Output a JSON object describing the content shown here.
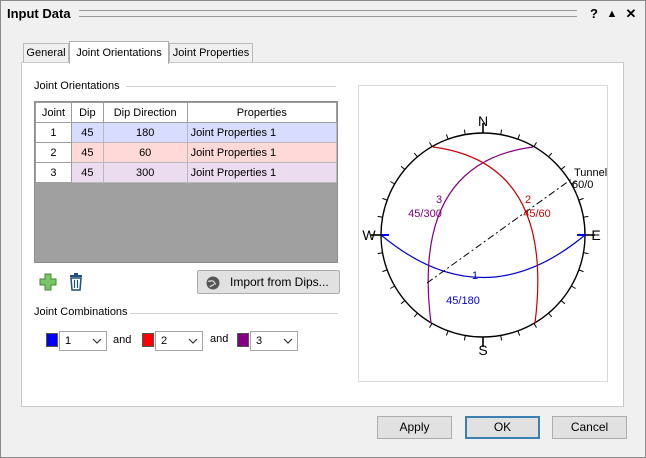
{
  "window": {
    "title": "Input Data"
  },
  "titlebar_buttons": {
    "help": "?",
    "up": "▲",
    "close": "✕"
  },
  "tabs": [
    {
      "label": "General"
    },
    {
      "label": "Joint Orientations"
    },
    {
      "label": "Joint Properties"
    }
  ],
  "joint_orientations": {
    "section_title": "Joint Orientations",
    "columns": [
      "Joint",
      "Dip",
      "Dip Direction",
      "Properties"
    ],
    "rows": [
      {
        "joint": "1",
        "dip": "45",
        "dip_direction": "180",
        "properties": "Joint Properties 1",
        "color": "#d8dcff"
      },
      {
        "joint": "2",
        "dip": "45",
        "dip_direction": "60",
        "properties": "Joint Properties 1",
        "color": "#ffd8d8"
      },
      {
        "joint": "3",
        "dip": "45",
        "dip_direction": "300",
        "properties": "Joint Properties 1",
        "color": "#ecdcf0"
      }
    ],
    "add_icon": "plus-icon",
    "delete_icon": "trash-icon",
    "import_button": "Import from Dips..."
  },
  "joint_combinations": {
    "section_title": "Joint Combinations",
    "and_label": "and",
    "combos": [
      {
        "value": "1",
        "color": "#0000ff"
      },
      {
        "value": "2",
        "color": "#ff0000"
      },
      {
        "value": "3",
        "color": "#800080"
      }
    ]
  },
  "stereonet": {
    "north": "N",
    "south": "S",
    "east": "E",
    "west": "W",
    "tunnel_label": "Tunnel",
    "tunnel_value": "60/0",
    "joint_labels": [
      {
        "id": "1",
        "orientation": "45/180",
        "color": "#0000cc"
      },
      {
        "id": "2",
        "orientation": "45/60",
        "color": "#cc0000"
      },
      {
        "id": "3",
        "orientation": "45/300",
        "color": "#800080"
      }
    ]
  },
  "buttons": {
    "apply": "Apply",
    "ok": "OK",
    "cancel": "Cancel"
  }
}
